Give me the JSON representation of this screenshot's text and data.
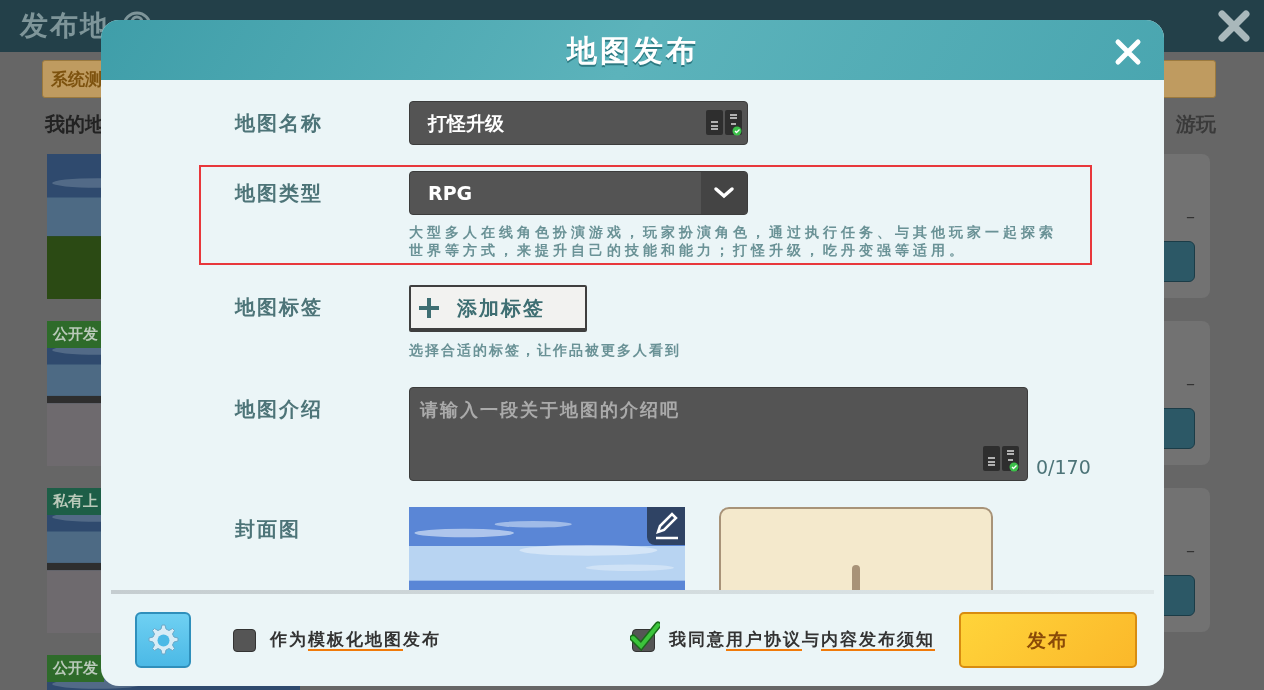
{
  "background": {
    "title": "发布地",
    "notice": "系统测",
    "heading": "我的地",
    "side_text": "游玩",
    "thumbnails": [
      {
        "kind": "picture"
      },
      {
        "kind": "picture",
        "label": "公开发",
        "color": "#2e6b2a"
      },
      {
        "kind": "picture",
        "label": "私有上",
        "color": "#1d5e47"
      },
      {
        "kind": "picture",
        "label": "公开发",
        "color": "#2e6b2a"
      }
    ],
    "cards": [
      {
        "value": "–"
      },
      {
        "value": "–"
      },
      {
        "value": "–"
      }
    ]
  },
  "dialog": {
    "title": "地图发布",
    "fields": [
      {
        "kind": "text",
        "label": "地图名称",
        "value": "打怪升级",
        "highlighted": false
      },
      {
        "kind": "select",
        "label": "地图类型",
        "value": "RPG",
        "description": "大型多人在线角色扮演游戏，玩家扮演角色，通过执行任务、与其他玩家一起探索世界等方式，来提升自己的技能和能力；打怪升级，吃丹变强等适用。",
        "highlighted": true
      },
      {
        "kind": "tags",
        "label": "地图标签",
        "button": "添加标签",
        "hint": "选择合适的标签，让作品被更多人看到",
        "highlighted": false
      },
      {
        "kind": "textarea",
        "label": "地图介绍",
        "placeholder": "请输入一段关于地图的介绍吧",
        "counter": "0/170",
        "highlighted": false
      },
      {
        "kind": "cover",
        "label": "封面图",
        "highlighted": false
      }
    ],
    "footer": {
      "options": [
        {
          "checked": false,
          "segments": [
            {
              "text": "作为",
              "link": false
            },
            {
              "text": "模板化地图",
              "link": true
            },
            {
              "text": "发布",
              "link": false
            }
          ]
        },
        {
          "checked": true,
          "segments": [
            {
              "text": "我同意",
              "link": false
            },
            {
              "text": "用户协议",
              "link": true
            },
            {
              "text": "与",
              "link": false
            },
            {
              "text": "内容发布须知",
              "link": true
            }
          ]
        }
      ],
      "publish": "发布"
    }
  }
}
